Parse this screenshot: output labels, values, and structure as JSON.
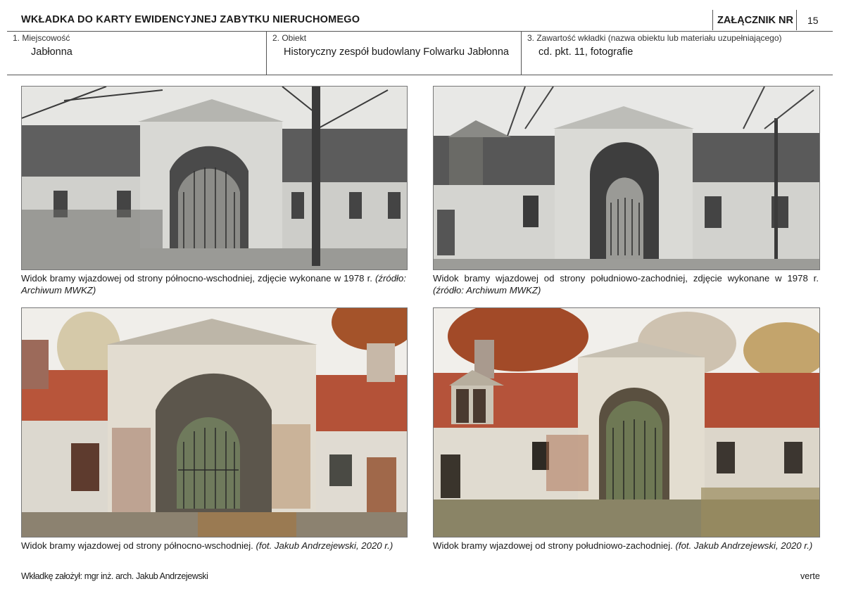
{
  "header": {
    "title": "WKŁADKA DO KARTY EWIDENCYJNEJ ZABYTKU NIERUCHOMEGO",
    "annex_label": "ZAŁĄCZNIK NR",
    "page_number": "15"
  },
  "fields": [
    {
      "label": "1. Miejscowość",
      "value": "Jabłonna"
    },
    {
      "label": "2. Obiekt",
      "value": "Historyczny zespół budowlany Folwarku Jabłonna"
    },
    {
      "label": "3. Zawartość wkładki (nazwa obiektu lub materiału uzupełniającego)",
      "value": "cd. pkt. 11, fotografie"
    }
  ],
  "photos": [
    {
      "caption": "Widok bramy wjazdowej od strony północno-wschodniej, zdjęcie wykonane w 1978 r.",
      "source": "(źródło: Archiwum MWKZ)"
    },
    {
      "caption": "Widok bramy wjazdowej od strony południowo-zachodniej, zdjęcie wykonane w 1978 r.",
      "source": "(źródło: Archiwum MWKZ)"
    },
    {
      "caption": "Widok bramy wjazdowej od strony północno-wschodniej.",
      "source": "(fot. Jakub Andrzejewski, 2020 r.)"
    },
    {
      "caption": "Widok bramy wjazdowej od strony południowo-zachodniej.",
      "source": "(fot. Jakub Andrzejewski, 2020 r.)"
    }
  ],
  "footer": {
    "author": "Wkładkę założył: mgr inż. arch. Jakub Andrzejewski",
    "verte": "verte"
  }
}
